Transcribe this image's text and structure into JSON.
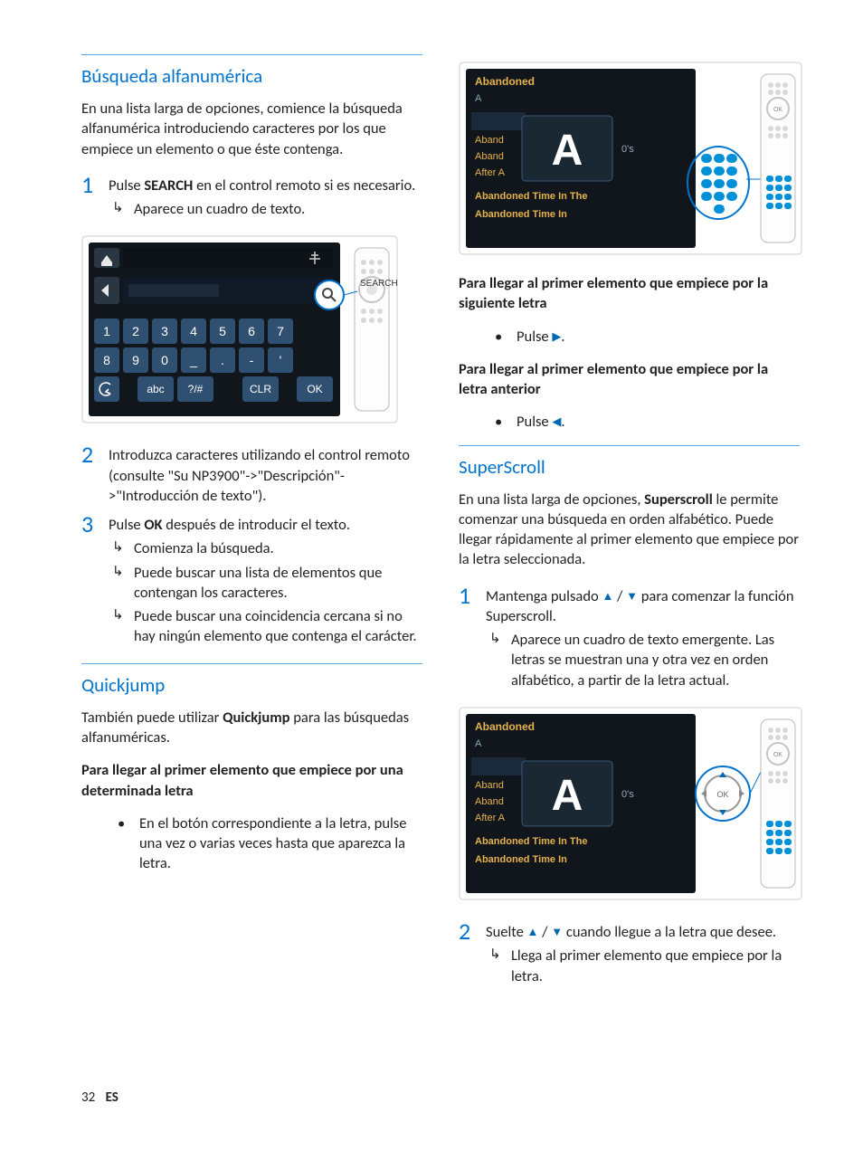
{
  "col1": {
    "h_alpha": "Búsqueda alfanumérica",
    "p_alpha": "En una lista larga de opciones, comience la búsqueda alfanumérica introduciendo caracteres por los que empiece un elemento o que éste contenga.",
    "step1_a": "Pulse ",
    "step1_b": "SEARCH",
    "step1_c": " en el control remoto si es necesario.",
    "step1_sub": "Aparece un cuadro de texto.",
    "step2": "Introduzca caracteres utilizando el control remoto (consulte \"Su NP3900\"->\"Descripción\"->\"Introducción de texto\").",
    "step3_a": "Pulse ",
    "step3_b": "OK",
    "step3_c": " después de introducir el texto.",
    "step3_sub1": "Comienza la búsqueda.",
    "step3_sub2": "Puede buscar una lista de elementos que contengan los caracteres.",
    "step3_sub3": "Puede buscar una coincidencia cercana si no hay ningún elemento que contenga el carácter.",
    "h_quick": "Quickjump",
    "p_quick_a": "También puede utilizar ",
    "p_quick_b": "Quickjump",
    "p_quick_c": " para las búsquedas alfanuméricas.",
    "p_quick2": "Para llegar al primer elemento que empiece por una determinada letra",
    "b_quick": "En el botón correspondiente a la letra, pulse una vez o varias veces hasta que aparezca la letra.",
    "img1": {
      "keys_row1": [
        "1",
        "2",
        "3",
        "4",
        "5",
        "6",
        "7"
      ],
      "keys_row2": [
        "8",
        "9",
        "0",
        "_",
        ".",
        "-",
        "'"
      ],
      "keys_row3_left": [
        "abc",
        "?/#"
      ],
      "keys_row3_clr": "CLR",
      "keys_row3_ok": "OK",
      "callout": "SEARCH"
    }
  },
  "col2": {
    "p_next": "Para llegar al primer elemento que empiece por la siguiente letra",
    "b_next": "Pulse ",
    "p_prev": "Para llegar al primer elemento que empiece por la letra anterior",
    "b_prev": "Pulse ",
    "h_super": "SuperScroll",
    "p_super_a": "En una lista larga de opciones, ",
    "p_super_b": "Superscroll",
    "p_super_c": " le permite comenzar una búsqueda en orden alfabético. Puede llegar rápidamente al primer elemento que empiece por la letra seleccionada.",
    "ss_step1_a": "Mantenga pulsado ",
    "ss_step1_b": " para comenzar la función Superscroll.",
    "ss_step1_sub": "Aparece un cuadro de texto emergente. Las letras se muestran una y otra vez en orden alfabético, a partir de la letra actual.",
    "ss_step2_a": "Suelte ",
    "ss_step2_b": " cuando llegue a la letra que desee.",
    "ss_step2_sub": "Llega al primer elemento que empiece por la letra.",
    "img_list": {
      "title": "Abandoned",
      "items": [
        "A",
        "",
        "Aband",
        "Aband",
        "After A",
        "Abandoned Time In The",
        "Abandoned Time In"
      ],
      "letter": "A",
      "suffix": "0's",
      "ok": "OK"
    }
  },
  "footer": {
    "page": "32",
    "lang": "ES"
  }
}
